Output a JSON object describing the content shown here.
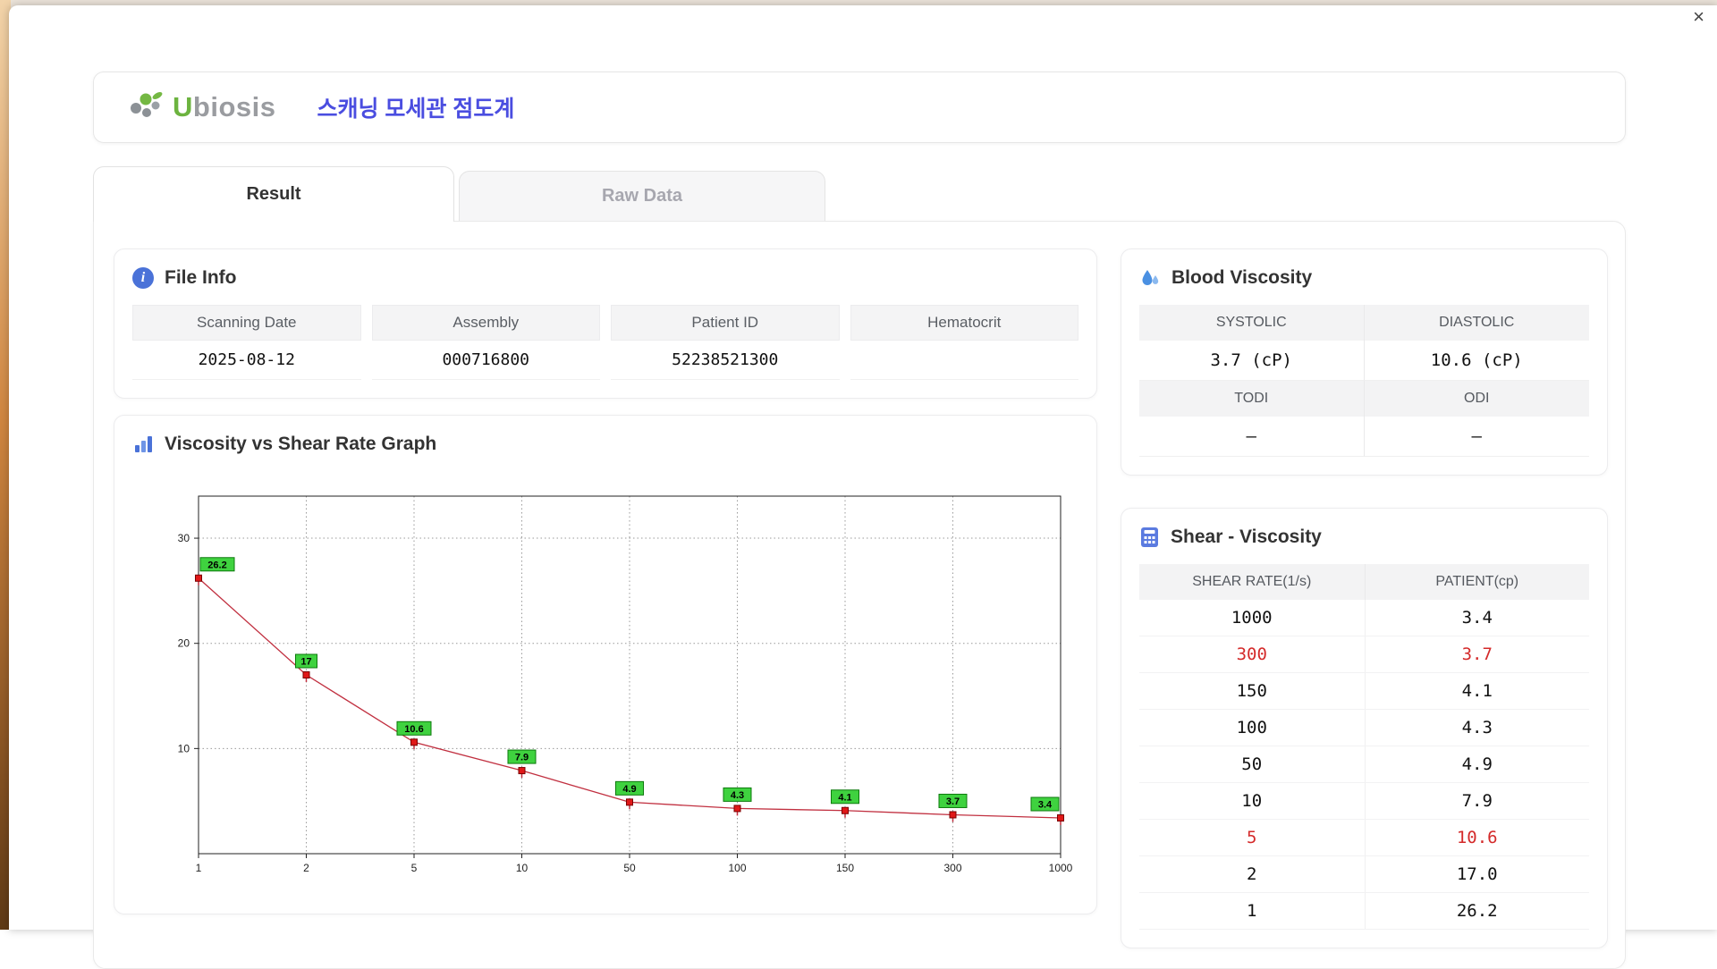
{
  "window": {
    "close_icon": "×"
  },
  "header": {
    "brand_prefix": "U",
    "brand_rest": "biosis",
    "title": "스캐닝 모세관 점도계"
  },
  "tabs": [
    {
      "label": "Result",
      "active": true
    },
    {
      "label": "Raw Data",
      "active": false
    }
  ],
  "file_info": {
    "title": "File Info",
    "icon_glyph": "i",
    "fields": [
      {
        "label": "Scanning Date",
        "value": "2025-08-12"
      },
      {
        "label": "Assembly",
        "value": "000716800"
      },
      {
        "label": "Patient ID",
        "value": "52238521300"
      },
      {
        "label": "Hematocrit",
        "value": ""
      }
    ]
  },
  "blood_viscosity": {
    "title": "Blood Viscosity",
    "systolic_label": "SYSTOLIC",
    "diastolic_label": "DIASTOLIC",
    "systolic_value": "3.7 (cP)",
    "diastolic_value": "10.6 (cP)",
    "todi_label": "TODI",
    "odi_label": "ODI",
    "todi_value": "–",
    "odi_value": "–"
  },
  "shear_viscosity": {
    "title": "Shear - Viscosity",
    "columns": [
      "SHEAR RATE(1/s)",
      "PATIENT(cp)"
    ],
    "rows": [
      {
        "shear": "1000",
        "patient": "3.4",
        "highlight": false
      },
      {
        "shear": "300",
        "patient": "3.7",
        "highlight": true
      },
      {
        "shear": "150",
        "patient": "4.1",
        "highlight": false
      },
      {
        "shear": "100",
        "patient": "4.3",
        "highlight": false
      },
      {
        "shear": "50",
        "patient": "4.9",
        "highlight": false
      },
      {
        "shear": "10",
        "patient": "7.9",
        "highlight": false
      },
      {
        "shear": "5",
        "patient": "10.6",
        "highlight": true
      },
      {
        "shear": "2",
        "patient": "17.0",
        "highlight": false
      },
      {
        "shear": "1",
        "patient": "26.2",
        "highlight": false
      }
    ],
    "highlight_color": "#d42a2a"
  },
  "chart_data": {
    "type": "line",
    "title": "Viscosity vs Shear Rate Graph",
    "xlabel": "",
    "ylabel": "",
    "x": [
      1,
      2,
      5,
      10,
      50,
      100,
      150,
      300,
      1000
    ],
    "values": [
      26.2,
      17,
      10.6,
      7.9,
      4.9,
      4.3,
      4.1,
      3.7,
      3.4
    ],
    "labels": [
      "26.2",
      "17",
      "10.6",
      "7.9",
      "4.9",
      "4.3",
      "4.1",
      "3.7",
      "3.4"
    ],
    "yticks": [
      10,
      20,
      30
    ],
    "ylim": [
      0,
      34
    ],
    "x_axis_note": "ticks equally spaced (pseudo-log categories)",
    "grid": "dotted",
    "legend": "none",
    "line_color": "#c13040",
    "marker_fill": "#e01818",
    "marker_stroke": "#7a0000",
    "label_bg": "#3fd23f",
    "label_border": "#0c7a0c"
  }
}
